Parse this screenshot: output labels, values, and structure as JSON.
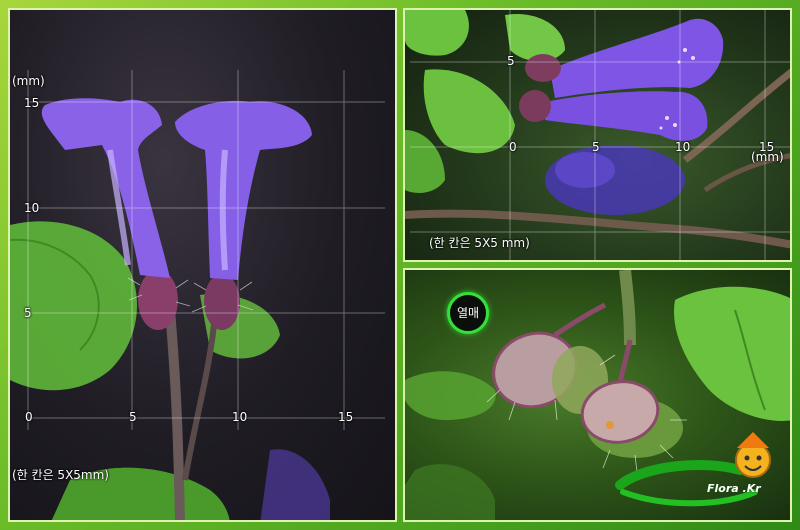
{
  "left_panel": {
    "unit_label": "(mm)",
    "y_ticks": [
      "15",
      "10",
      "5"
    ],
    "x_ticks": [
      "0",
      "5",
      "10",
      "15"
    ],
    "caption": "(한 칸은 5X5mm)"
  },
  "top_right_panel": {
    "y_tick": "5",
    "x_ticks": [
      "0",
      "5",
      "10",
      "15"
    ],
    "unit_label": "(mm)",
    "caption": "(한 칸은 5X5 mm)"
  },
  "bottom_right_panel": {
    "badge_label": "열매",
    "logo_text": "Flora .Kr"
  },
  "colors": {
    "flower_violet": "#7a4fe0",
    "leaf_green": "#5fb83a",
    "frame_green": "#6fbf2a"
  }
}
